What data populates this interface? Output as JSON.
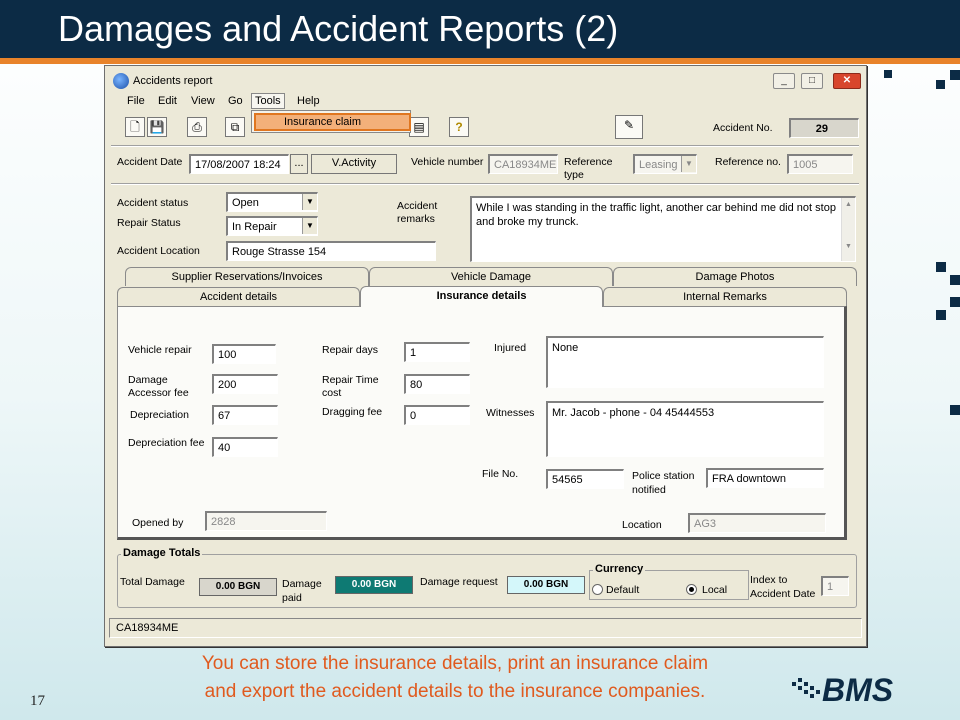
{
  "slide": {
    "title": "Damages and Accident Reports (2)",
    "slide_number": "17",
    "caption_line1": "You can store the insurance details, print an insurance claim",
    "caption_line2": "and export the accident details to the insurance companies.",
    "logo_text": "BMS",
    "colors": {
      "header": "#0c2b45",
      "accent": "#e8832a",
      "caption": "#e05a1e"
    }
  },
  "window": {
    "title": "Accidents report",
    "min_icon": "minimize-icon",
    "max_icon": "maximize-icon",
    "close_icon": "close-icon"
  },
  "menu": {
    "items": [
      "File",
      "Edit",
      "View",
      "Go",
      "Tools",
      "Help"
    ],
    "tools_dropdown": [
      "Insurance claim"
    ]
  },
  "toolbar": {
    "icons": [
      "new-icon",
      "save-icon",
      "print-icon",
      "copy-icon",
      "help-icon",
      "edit-report-icon"
    ],
    "accident_no_label": "Accident No.",
    "accident_no_value": "29"
  },
  "header_fields": {
    "accident_date_label": "Accident Date",
    "accident_date_value": "17/08/2007 18:24",
    "browse_button": "...",
    "v_activity_button": "V.Activity",
    "vehicle_number_label": "Vehicle number",
    "vehicle_number_value": "CA18934ME",
    "reference_type_label_1": "Reference",
    "reference_type_label_2": "type",
    "reference_type_value": "Leasing",
    "reference_no_label": "Reference no.",
    "reference_no_value": "1005"
  },
  "status_fields": {
    "accident_status_label": "Accident status",
    "accident_status_value": "Open",
    "repair_status_label": "Repair Status",
    "repair_status_value": "In Repair",
    "accident_location_label": "Accident Location",
    "accident_location_value": "Rouge Strasse 154",
    "accident_remarks_label_1": "Accident",
    "accident_remarks_label_2": "remarks",
    "accident_remarks_value": "While I was standing in the traffic light, another car behind me did not stop and broke my trunck."
  },
  "tabs": {
    "back_row": [
      "Supplier Reservations/Invoices",
      "Vehicle Damage",
      "Damage Photos"
    ],
    "front_row": [
      "Accident details",
      "Insurance details",
      "Internal Remarks"
    ],
    "selected": "Insurance details"
  },
  "insurance": {
    "vehicle_repair_label": "Vehicle repair",
    "vehicle_repair_value": "100",
    "damage_accessor_fee_label_1": "Damage",
    "damage_accessor_fee_label_2": "Accessor fee",
    "damage_accessor_fee_value": "200",
    "depreciation_label": "Depreciation",
    "depreciation_value": "67",
    "depreciation_fee_label": "Depreciation fee",
    "depreciation_fee_value": "40",
    "repair_days_label": "Repair days",
    "repair_days_value": "1",
    "repair_time_cost_label_1": "Repair Time",
    "repair_time_cost_label_2": "cost",
    "repair_time_cost_value": "80",
    "dragging_fee_label": "Dragging fee",
    "dragging_fee_value": "0",
    "injured_label": "Injured",
    "injured_value": "None",
    "witnesses_label": "Witnesses",
    "witnesses_value": "Mr. Jacob - phone - 04 45444553",
    "file_no_label": "File No.",
    "file_no_value": "54565",
    "police_station_label_1": "Police station",
    "police_station_label_2": "notified",
    "police_station_value": "FRA downtown",
    "opened_by_label": "Opened by",
    "opened_by_value": "2828",
    "location_label": "Location",
    "location_value": "AG3"
  },
  "damage_totals": {
    "group_title": "Damage Totals",
    "total_damage_label": "Total Damage",
    "total_damage_value": "0.00 BGN",
    "damage_paid_label_1": "Damage",
    "damage_paid_label_2": "paid",
    "damage_paid_value": "0.00 BGN",
    "damage_request_label": "Damage request",
    "damage_request_value": "0.00 BGN",
    "currency_title": "Currency",
    "currency_default": "Default",
    "currency_local": "Local",
    "currency_selected": "Local",
    "index_label_1": "Index to",
    "index_label_2": "Accident Date",
    "index_value": "1"
  },
  "statusbar": {
    "text": "CA18934ME"
  }
}
